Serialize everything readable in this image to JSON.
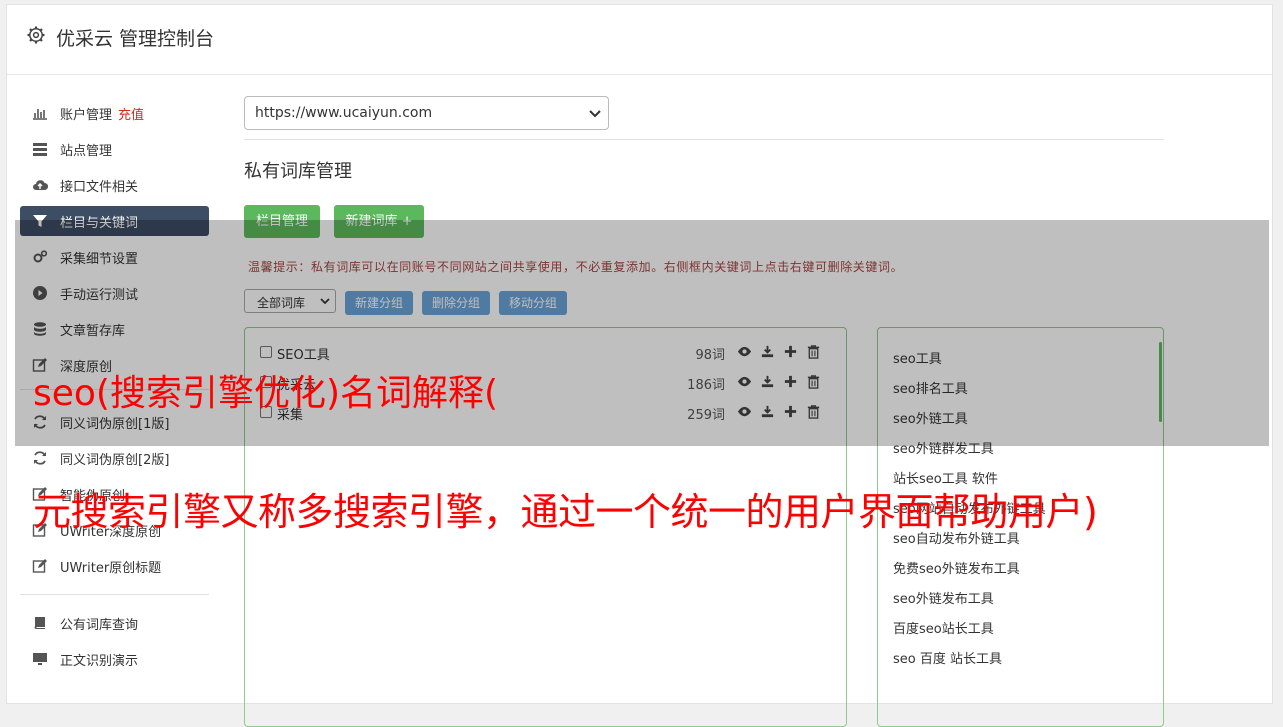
{
  "header": {
    "title": "优采云 管理控制台",
    "icon": "gear-icon"
  },
  "sidebar": {
    "items": [
      {
        "label": "账户管理",
        "extra": "充值",
        "icon": "bar-chart-icon"
      },
      {
        "label": "站点管理",
        "icon": "server-list-icon"
      },
      {
        "label": "接口文件相关",
        "icon": "cloud-upload-icon"
      },
      {
        "label": "栏目与关键词",
        "icon": "filter-icon",
        "active": true
      },
      {
        "label": "采集细节设置",
        "icon": "gears-icon"
      },
      {
        "label": "手动运行测试",
        "icon": "play-circle-icon"
      },
      {
        "label": "文章暂存库",
        "icon": "database-icon"
      },
      {
        "label": "深度原创",
        "icon": "edit-icon"
      },
      {
        "label": "同义词伪原创[1版]",
        "icon": "refresh-icon"
      },
      {
        "label": "同义词伪原创[2版]",
        "icon": "refresh-icon"
      },
      {
        "label": "智能伪原创",
        "icon": "edit-icon"
      },
      {
        "label": "UWriter深度原创",
        "icon": "edit-icon"
      },
      {
        "label": "UWriter原创标题",
        "icon": "edit-icon"
      },
      {
        "label": "公有词库查询",
        "icon": "book-icon"
      },
      {
        "label": "正文识别演示",
        "icon": "monitor-icon"
      }
    ]
  },
  "main": {
    "site_select": "https://www.ucaiyun.com",
    "section_title": "私有词库管理",
    "buttons": {
      "column_manage": "栏目管理",
      "new_library": "新建词库 +"
    },
    "tip": "温馨提示：私有词库可以在同账号不同网站之间共享使用，不必重复添加。右侧框内关键词上点击右键可删除关键词。",
    "group_select": "全部词库",
    "group_buttons": {
      "new": "新建分组",
      "delete": "删除分组",
      "move": "移动分组"
    },
    "libraries": [
      {
        "name": "SEO工具",
        "count": "98词"
      },
      {
        "name": "优采云",
        "count": "186词"
      },
      {
        "name": "采集",
        "count": "259词"
      }
    ],
    "keywords": [
      "seo工具",
      "seo排名工具",
      "seo外链工具",
      "seo外链群发工具",
      "站长seo工具 软件",
      "seo网站自动发布外链工具",
      "seo自动发布外链工具",
      "免费seo外链发布工具",
      "seo外链发布工具",
      "百度seo站长工具",
      "seo 百度 站长工具"
    ]
  },
  "overlay": {
    "line1": "seo(搜索引擎优化)名词解释(",
    "line2": "元搜索引擎又称多搜索引擎，通过一个统一的用户界面帮助用户)"
  },
  "colors": {
    "active": "#3d4d63",
    "green": "#5cb85c",
    "blue": "#6aa3d8",
    "tip": "#a94442",
    "overlay_text": "#ff0000"
  }
}
